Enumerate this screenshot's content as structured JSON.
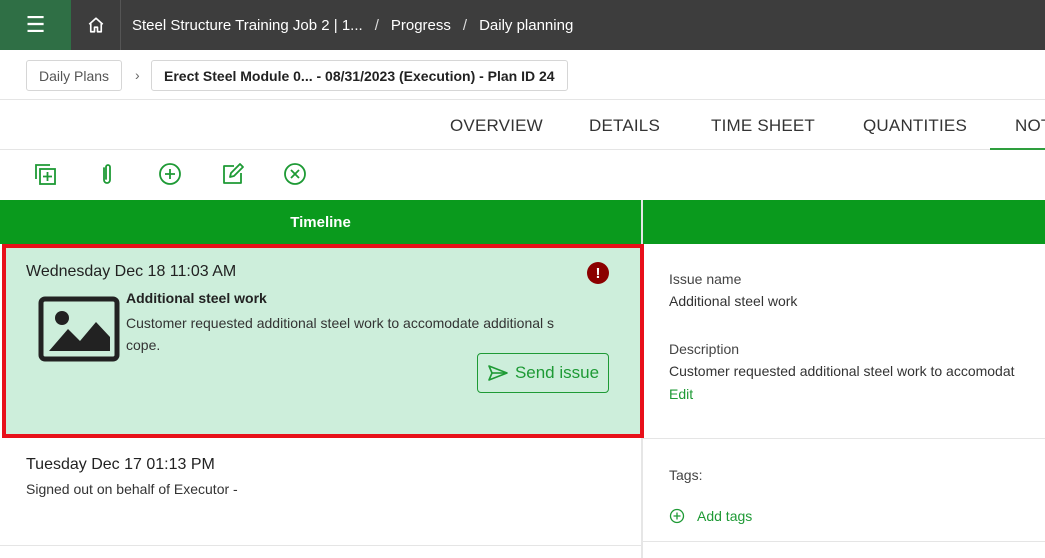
{
  "topbar": {
    "breadcrumb": [
      "Steel Structure Training Job 2 | 1...",
      "Progress",
      "Daily planning"
    ]
  },
  "plan_row": {
    "first": "Daily Plans",
    "second": "Erect Steel Module 0... - 08/31/2023 (Execution) - Plan ID 24"
  },
  "tabs": [
    "OVERVIEW",
    "DETAILS",
    "TIME SHEET",
    "QUANTITIES",
    "NOT"
  ],
  "active_tab": "NOT",
  "timeline": {
    "header": "Timeline",
    "items": [
      {
        "date": "Wednesday Dec 18 11:03 AM",
        "title": "Additional steel work",
        "description": "Customer requested additional steel work to accomodate additional scope.",
        "action": "Send issue"
      },
      {
        "date": "Tuesday Dec 17 01:13 PM",
        "text": "Signed out on behalf of Executor -"
      }
    ]
  },
  "details": {
    "issue_name_label": "Issue name",
    "issue_name_value": "Additional steel work",
    "description_label": "Description",
    "description_value": "Customer requested additional steel work to accomodat",
    "edit": "Edit",
    "tags_label": "Tags:",
    "add_tags": "Add tags"
  },
  "colors": {
    "accent_green": "#0a9a1d",
    "menu_green": "#2f6f45",
    "selected_bg": "#cdeedb",
    "highlight_border": "#e8101a",
    "alert": "#8b0000"
  }
}
